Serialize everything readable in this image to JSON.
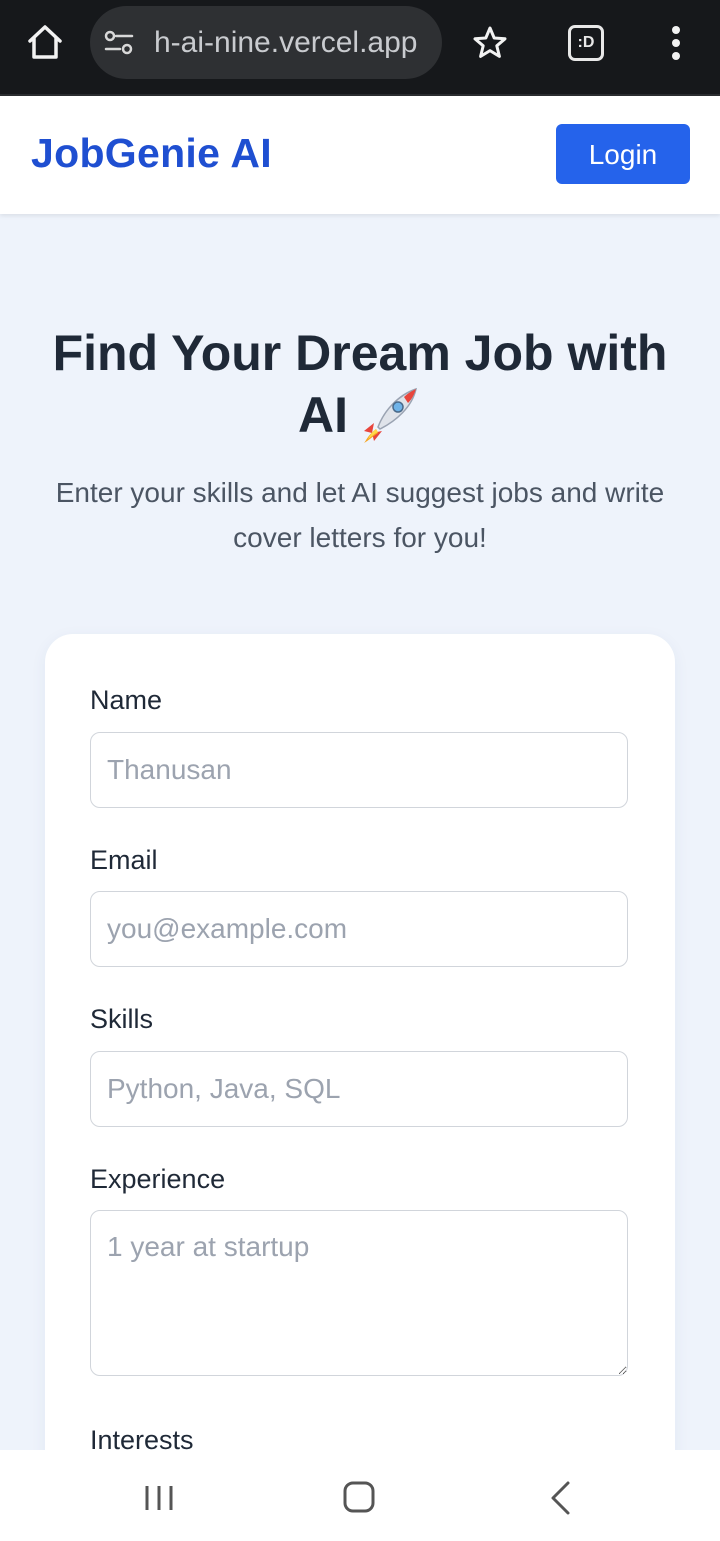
{
  "browser": {
    "url": "h-ai-nine.vercel.app",
    "tabs_icon_text": ":D",
    "icons": [
      "home-icon",
      "site-settings-icon",
      "star-icon",
      "tab-switcher-icon",
      "more-vert-icon"
    ]
  },
  "header": {
    "brand": "JobGenie AI",
    "login_label": "Login",
    "brand_color": "#1f4fd1",
    "button_color": "#2563eb"
  },
  "hero": {
    "title": "Find Your Dream Job with AI",
    "title_emoji_icon": "rocket-icon",
    "subtitle": "Enter your skills and let AI suggest jobs and write cover letters for you!"
  },
  "form": {
    "name_label": "Name",
    "name_placeholder": "Thanusan",
    "email_label": "Email",
    "email_placeholder": "you@example.com",
    "skills_label": "Skills",
    "skills_placeholder": "Python, Java, SQL",
    "experience_label": "Experience",
    "experience_placeholder": "1 year at startup",
    "interests_label": "Interests"
  },
  "system_nav": {
    "icons": [
      "recents-icon",
      "home-button-icon",
      "back-icon"
    ]
  }
}
